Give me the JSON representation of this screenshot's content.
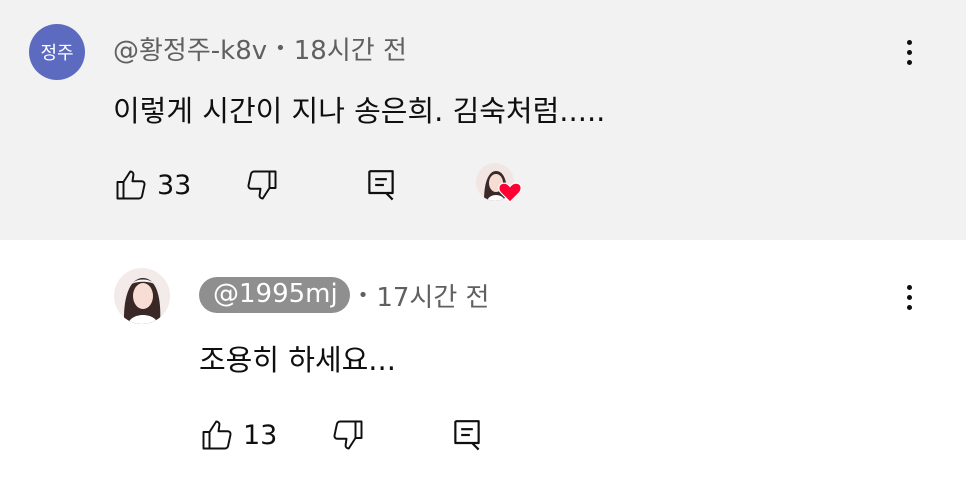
{
  "top_comment": {
    "avatar_text": "정주",
    "avatar_color": "#5c6bc0",
    "handle": "@황정주-k8v",
    "separator": "•",
    "time": "18시간 전",
    "text": "이렇게 시간이 지나 송은희. 김숙처럼.....",
    "likes": "33",
    "creator_heart": true
  },
  "reply": {
    "handle": "@1995mj",
    "separator": "•",
    "time": "17시간 전",
    "text": "조용히 하세요...",
    "likes": "13"
  },
  "icons": {
    "like": "thumbs-up-icon",
    "dislike": "thumbs-down-icon",
    "reply": "reply-comment-icon",
    "menu": "more-vert-icon",
    "heart": "heart-icon"
  },
  "colors": {
    "highlight_bg": "#f2f2f2",
    "heart": "#ff0033",
    "meta_text": "#606060",
    "chip_bg": "#8f8f8f"
  }
}
